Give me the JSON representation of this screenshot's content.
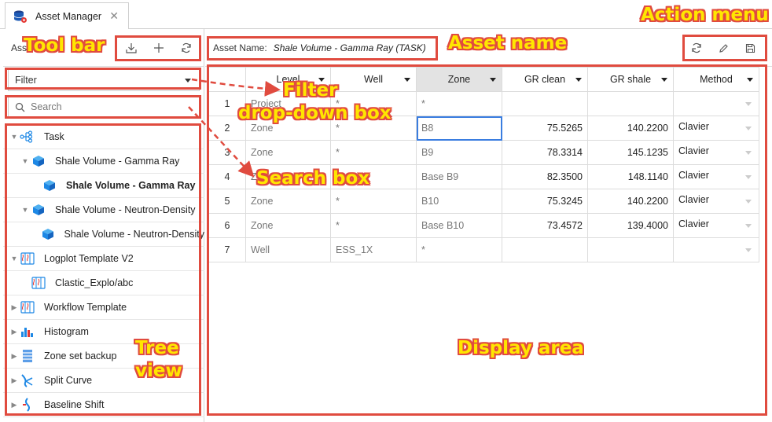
{
  "tab": {
    "label": "Asset Manager",
    "close": "✕"
  },
  "left": {
    "header_text": "Ass",
    "filter_label": "Filter",
    "search_placeholder": "Search",
    "tree": [
      {
        "label": "Task",
        "icon": "task-icon",
        "expand": "down",
        "indent": 0,
        "selected": false
      },
      {
        "label": "Shale Volume - Gamma Ray",
        "icon": "cube-icon",
        "expand": "down",
        "indent": 1,
        "selected": false
      },
      {
        "label": "Shale Volume - Gamma Ray",
        "icon": "cube-icon",
        "expand": "none",
        "indent": 2,
        "selected": true
      },
      {
        "label": "Shale Volume - Neutron-Density",
        "icon": "cube-icon",
        "expand": "down",
        "indent": 1,
        "selected": false
      },
      {
        "label": "Shale Volume - Neutron-Density",
        "icon": "cube-icon",
        "expand": "none",
        "indent": 2,
        "selected": false
      },
      {
        "label": "Logplot Template V2",
        "icon": "logplot-icon",
        "expand": "down",
        "indent": 0,
        "selected": false
      },
      {
        "label": "Clastic_Explo/abc",
        "icon": "logplot-icon",
        "expand": "none",
        "indent": 1,
        "selected": false
      },
      {
        "label": "Workflow Template",
        "icon": "logplot-icon",
        "expand": "right",
        "indent": 0,
        "selected": false
      },
      {
        "label": "Histogram",
        "icon": "histogram-icon",
        "expand": "right",
        "indent": 0,
        "selected": false
      },
      {
        "label": "Zone set backup",
        "icon": "zoneset-icon",
        "expand": "right",
        "indent": 0,
        "selected": false
      },
      {
        "label": "Split Curve",
        "icon": "split-curve-icon",
        "expand": "right",
        "indent": 0,
        "selected": false
      },
      {
        "label": "Baseline Shift",
        "icon": "baseline-shift-icon",
        "expand": "right",
        "indent": 0,
        "selected": false
      }
    ]
  },
  "asset": {
    "key": "Asset Name:",
    "value": "Shale Volume - Gamma Ray (TASK)"
  },
  "grid": {
    "columns": [
      "Level",
      "Well",
      "Zone",
      "GR clean",
      "GR shale",
      "Method"
    ],
    "rows": [
      {
        "n": "1",
        "level": "Project",
        "well": "*",
        "zone": "*",
        "grclean": "",
        "grshale": "",
        "method": ""
      },
      {
        "n": "2",
        "level": "Zone",
        "well": "*",
        "zone": "B8",
        "grclean": "75.5265",
        "grshale": "140.2200",
        "method": "Clavier"
      },
      {
        "n": "3",
        "level": "Zone",
        "well": "*",
        "zone": "B9",
        "grclean": "78.3314",
        "grshale": "145.1235",
        "method": "Clavier"
      },
      {
        "n": "4",
        "level": "Zone",
        "well": "*",
        "zone": "Base B9",
        "grclean": "82.3500",
        "grshale": "148.1140",
        "method": "Clavier"
      },
      {
        "n": "5",
        "level": "Zone",
        "well": "*",
        "zone": "B10",
        "grclean": "75.3245",
        "grshale": "140.2200",
        "method": "Clavier"
      },
      {
        "n": "6",
        "level": "Zone",
        "well": "*",
        "zone": "Base B10",
        "grclean": "73.4572",
        "grshale": "139.4000",
        "method": "Clavier"
      },
      {
        "n": "7",
        "level": "Well",
        "well": "ESS_1X",
        "zone": "*",
        "grclean": "",
        "grshale": "",
        "method": ""
      }
    ]
  },
  "annotations": {
    "toolbar": "Tool bar",
    "asset_name": "Asset name",
    "action_menu": "Action menu",
    "filter_line1": "Filter",
    "filter_line2": "drop-down box",
    "search_box": "Search box",
    "tree_line1": "Tree",
    "tree_line2": "view",
    "display_area": "Display area"
  },
  "colors": {
    "annotation_border": "#e04b3f",
    "annotation_text": "#ffe600",
    "selection": "#1e6ed8",
    "icon_blue": "#1e88e5"
  }
}
